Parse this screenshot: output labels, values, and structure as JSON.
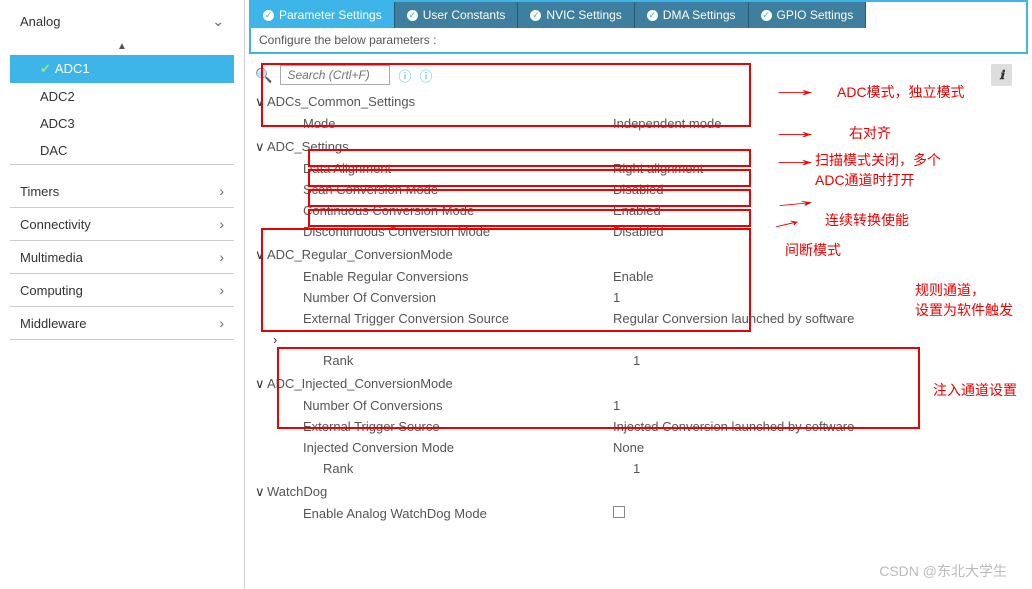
{
  "sidebar": {
    "sections": [
      {
        "label": "Analog",
        "expanded": true,
        "items": [
          {
            "label": "ADC1",
            "active": true
          },
          {
            "label": "ADC2",
            "active": false
          },
          {
            "label": "ADC3",
            "active": false
          },
          {
            "label": "DAC",
            "active": false
          }
        ]
      },
      {
        "label": "Timers"
      },
      {
        "label": "Connectivity"
      },
      {
        "label": "Multimedia"
      },
      {
        "label": "Computing"
      },
      {
        "label": "Middleware"
      }
    ]
  },
  "tabs": [
    {
      "label": "Parameter Settings",
      "active": true
    },
    {
      "label": "User Constants"
    },
    {
      "label": "NVIC Settings"
    },
    {
      "label": "DMA Settings"
    },
    {
      "label": "GPIO Settings"
    }
  ],
  "config_hint": "Configure the below parameters :",
  "search": {
    "placeholder": "Search (Crtl+F)"
  },
  "tree": {
    "common": {
      "label": "ADCs_Common_Settings",
      "mode_label": "Mode",
      "mode_val": "Independent mode"
    },
    "settings": {
      "label": "ADC_Settings",
      "rows": [
        {
          "name": "Data Alignment",
          "val": "Right alignment"
        },
        {
          "name": "Scan Conversion Mode",
          "val": "Disabled"
        },
        {
          "name": "Continuous Conversion Mode",
          "val": "Enabled"
        },
        {
          "name": "Discontinuous Conversion Mode",
          "val": "Disabled"
        }
      ]
    },
    "regular": {
      "label": "ADC_Regular_ConversionMode",
      "rows": [
        {
          "name": "Enable Regular Conversions",
          "val": "Enable"
        },
        {
          "name": "Number Of Conversion",
          "val": "1"
        },
        {
          "name": "External Trigger Conversion Source",
          "val": "Regular Conversion launched by software"
        }
      ],
      "rank_label": "Rank",
      "rank_val": "1"
    },
    "injected": {
      "label": "ADC_Injected_ConversionMode",
      "rows": [
        {
          "name": "Number Of Conversions",
          "val": "1"
        },
        {
          "name": "External Trigger Source",
          "val": "Injected Conversion launched by software"
        },
        {
          "name": "Injected Conversion Mode",
          "val": "None"
        }
      ],
      "rank_label": "Rank",
      "rank_val": "1"
    },
    "watchdog": {
      "label": "WatchDog",
      "row_label": "Enable Analog WatchDog Mode"
    }
  },
  "annotations": {
    "a1": "ADC模式，独立模式",
    "a2": "右对齐",
    "a3": "扫描模式关闭，多个",
    "a3b": "ADC通道时打开",
    "a4": "连续转换使能",
    "a5": "间断模式",
    "a6a": "规则通道，",
    "a6b": "设置为软件触发",
    "a7": "注入通道设置"
  },
  "watermark": "CSDN @东北大学生"
}
